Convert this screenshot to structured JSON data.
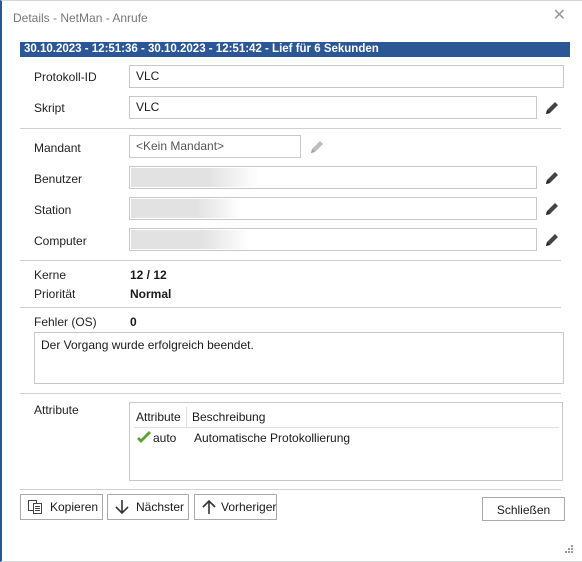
{
  "window": {
    "title": "Details - NetMan - Anrufe",
    "close_label": "✕"
  },
  "banner": "30.10.2023 - 12:51:36 - 30.10.2023 - 12:51:42 - Lief für 6 Sekunden",
  "fields": {
    "protokoll_id": {
      "label": "Protokoll-ID",
      "value": "VLC"
    },
    "skript": {
      "label": "Skript",
      "value": "VLC"
    },
    "mandant": {
      "label": "Mandant",
      "value": "<Kein Mandant>"
    },
    "benutzer": {
      "label": "Benutzer",
      "value": ""
    },
    "station": {
      "label": "Station",
      "value": ""
    },
    "computer": {
      "label": "Computer",
      "value": ""
    }
  },
  "info": {
    "kerne": {
      "label": "Kerne",
      "value": "12 / 12"
    },
    "prioritaet": {
      "label": "Priorität",
      "value": "Normal"
    },
    "fehler": {
      "label": "Fehler (OS)",
      "value": "0"
    }
  },
  "message": "Der Vorgang wurde erfolgreich beendet.",
  "attributes": {
    "label": "Attribute",
    "columns": [
      "Attribute",
      "Beschreibung"
    ],
    "rows": [
      {
        "attribute": "auto",
        "description": "Automatische Protokollierung"
      }
    ]
  },
  "buttons": {
    "copy": "Kopieren",
    "next": "Nächster",
    "previous": "Vorheriger",
    "close": "Schließen"
  },
  "colors": {
    "accent": "#2b5797",
    "check": "#5aa532"
  }
}
